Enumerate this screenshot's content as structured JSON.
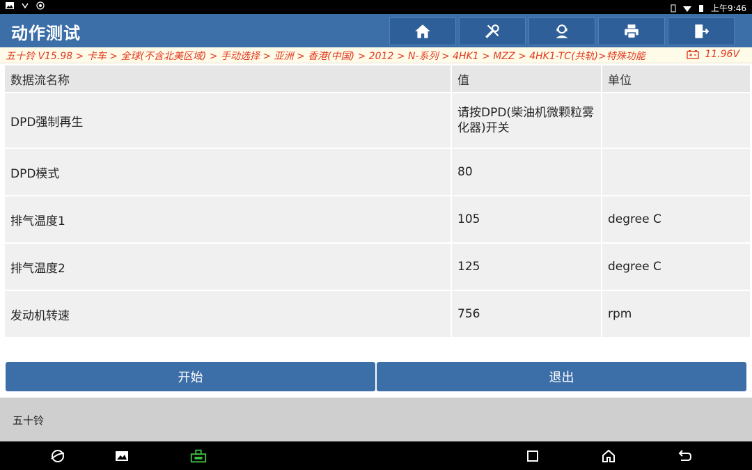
{
  "status_bar": {
    "time": "上午9:46",
    "icons": [
      "image-icon",
      "usb-icon",
      "bug-icon",
      "vibrate-icon",
      "wifi-icon",
      "battery-icon"
    ]
  },
  "header": {
    "title": "动作测试",
    "toolbar": [
      {
        "name": "home-icon"
      },
      {
        "name": "tools-icon"
      },
      {
        "name": "support-icon"
      },
      {
        "name": "print-icon"
      },
      {
        "name": "exit-icon"
      }
    ]
  },
  "breadcrumb": {
    "text": "五十铃 V15.98 > 卡车 > 全球(不含北美区域) > 手动选择 > 亚洲 > 香港(中国) > 2012 > N-系列 > 4HK1 > MZZ > 4HK1-TC(共轨)>特殊功能",
    "voltage": "11.96V"
  },
  "table": {
    "headers": [
      "数据流名称",
      "值",
      "单位"
    ],
    "rows": [
      {
        "name": "DPD强制再生",
        "value": "请按DPD(柴油机微颗粒雾化器)开关",
        "unit": ""
      },
      {
        "name": "DPD模式",
        "value": "80",
        "unit": ""
      },
      {
        "name": "排气温度1",
        "value": "105",
        "unit": "degree C"
      },
      {
        "name": "排气温度2",
        "value": "125",
        "unit": "degree C"
      },
      {
        "name": "发动机转速",
        "value": "756",
        "unit": "rpm"
      }
    ]
  },
  "buttons": {
    "start": "开始",
    "exit": "退出"
  },
  "info_bar": {
    "text": "五十铃"
  },
  "nav_bar": {
    "icons": [
      "browser-icon",
      "gallery-icon",
      "vci-icon",
      "recent-apps-icon",
      "home-nav-icon",
      "back-icon"
    ]
  },
  "colors": {
    "header_bg": "#3c6ea8",
    "breadcrumb_text": "#e03a1e",
    "button_bg": "#3c6ea8"
  }
}
